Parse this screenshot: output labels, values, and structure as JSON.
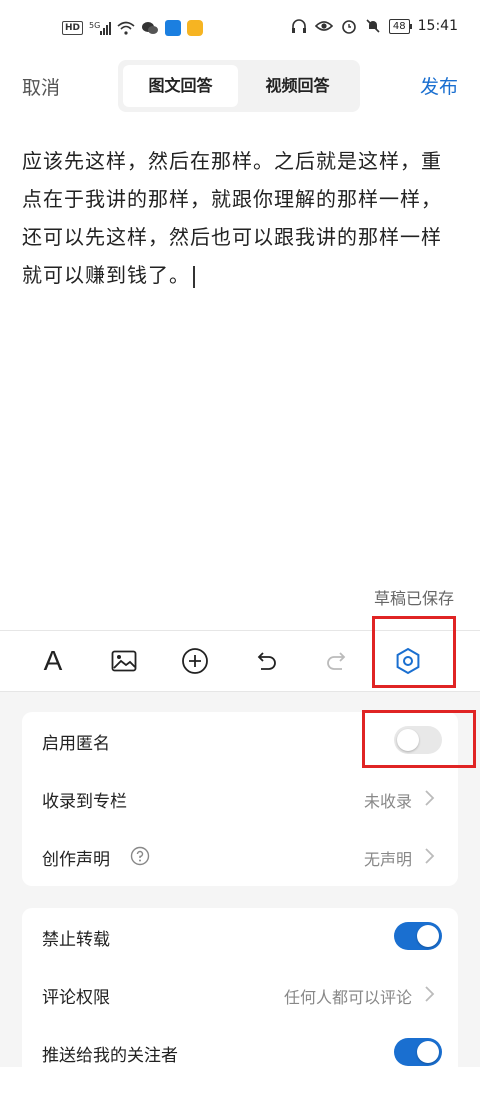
{
  "status_bar": {
    "hd": "HD",
    "signal_sup": "5G",
    "time": "15:41",
    "battery": "48"
  },
  "top_bar": {
    "cancel": "取消",
    "tabs": [
      "图文回答",
      "视频回答"
    ],
    "publish": "发布"
  },
  "editor": {
    "text": "应该先这样，然后在那样。之后就是这样，重点在于我讲的那样，就跟你理解的那样一样，还可以先这样，然后也可以跟我讲的那样一样就可以赚到钱了。"
  },
  "draft_status": "草稿已保存",
  "toolbar": {
    "icons": [
      "text-format-icon",
      "image-icon",
      "add-circle-icon",
      "undo-icon",
      "redo-icon",
      "settings-hexagon-icon"
    ],
    "text_glyph": "A"
  },
  "settings": {
    "group1": [
      {
        "label": "启用匿名",
        "type": "toggle",
        "on": false
      },
      {
        "label": "收录到专栏",
        "type": "link",
        "value": "未收录"
      },
      {
        "label": "创作声明",
        "type": "link",
        "value": "无声明",
        "help": true
      }
    ],
    "group2": [
      {
        "label": "禁止转载",
        "type": "toggle",
        "on": true
      },
      {
        "label": "评论权限",
        "type": "link",
        "value": "任何人都可以评论"
      },
      {
        "label": "推送给我的关注者",
        "type": "toggle",
        "on": true
      }
    ]
  },
  "colors": {
    "accent": "#1a6fd0",
    "highlight": "#e02424"
  }
}
